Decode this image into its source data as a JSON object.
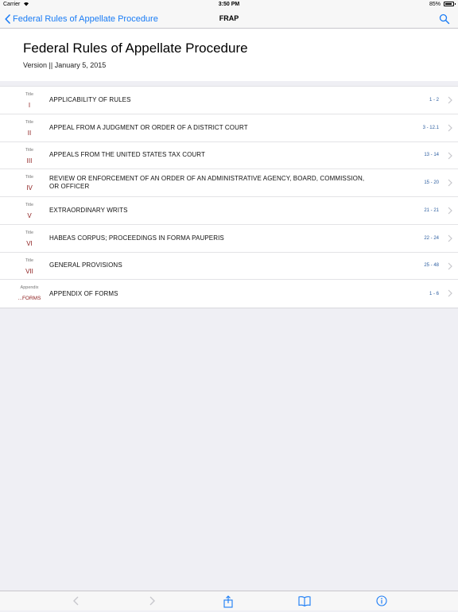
{
  "status_bar": {
    "carrier": "Carrier",
    "time": "3:50 PM",
    "battery_percent": "85%",
    "battery_level": 0.85
  },
  "nav": {
    "back_label": "Federal Rules of Appellate Procedure",
    "title": "FRAP",
    "accent_color": "#1a7cf5"
  },
  "header": {
    "title": "Federal Rules of Appellate Procedure",
    "version": "Version || January 5, 2015"
  },
  "toc": {
    "items": [
      {
        "label": "Title",
        "number": "I",
        "text": "APPLICABILITY OF RULES",
        "range": "1 - 2"
      },
      {
        "label": "Title",
        "number": "II",
        "text": "APPEAL FROM A JUDGMENT OR ORDER OF A DISTRICT COURT",
        "range": "3 - 12.1"
      },
      {
        "label": "Title",
        "number": "III",
        "text": "APPEALS FROM THE UNITED STATES TAX COURT",
        "range": "13 - 14"
      },
      {
        "label": "Title",
        "number": "IV",
        "text": "REVIEW OR ENFORCEMENT OF AN ORDER OF AN ADMINISTRATIVE AGENCY, BOARD, COMMISSION, OR OFFICER",
        "range": "15 - 20"
      },
      {
        "label": "Title",
        "number": "V",
        "text": "EXTRAORDINARY WRITS",
        "range": "21 - 21"
      },
      {
        "label": "Title",
        "number": "VI",
        "text": "HABEAS CORPUS; PROCEEDINGS IN FORMA PAUPERIS",
        "range": "22 - 24"
      },
      {
        "label": "Title",
        "number": "VII",
        "text": "GENERAL PROVISIONS",
        "range": "25 - 48"
      },
      {
        "label": "Appendix",
        "number": "...FORMS",
        "text": "APPENDIX OF FORMS",
        "range": "1 - 6"
      }
    ]
  },
  "toolbar": {
    "buttons": [
      "back-arrow-icon",
      "forward-arrow-icon",
      "share-icon",
      "book-icon",
      "info-icon"
    ]
  }
}
